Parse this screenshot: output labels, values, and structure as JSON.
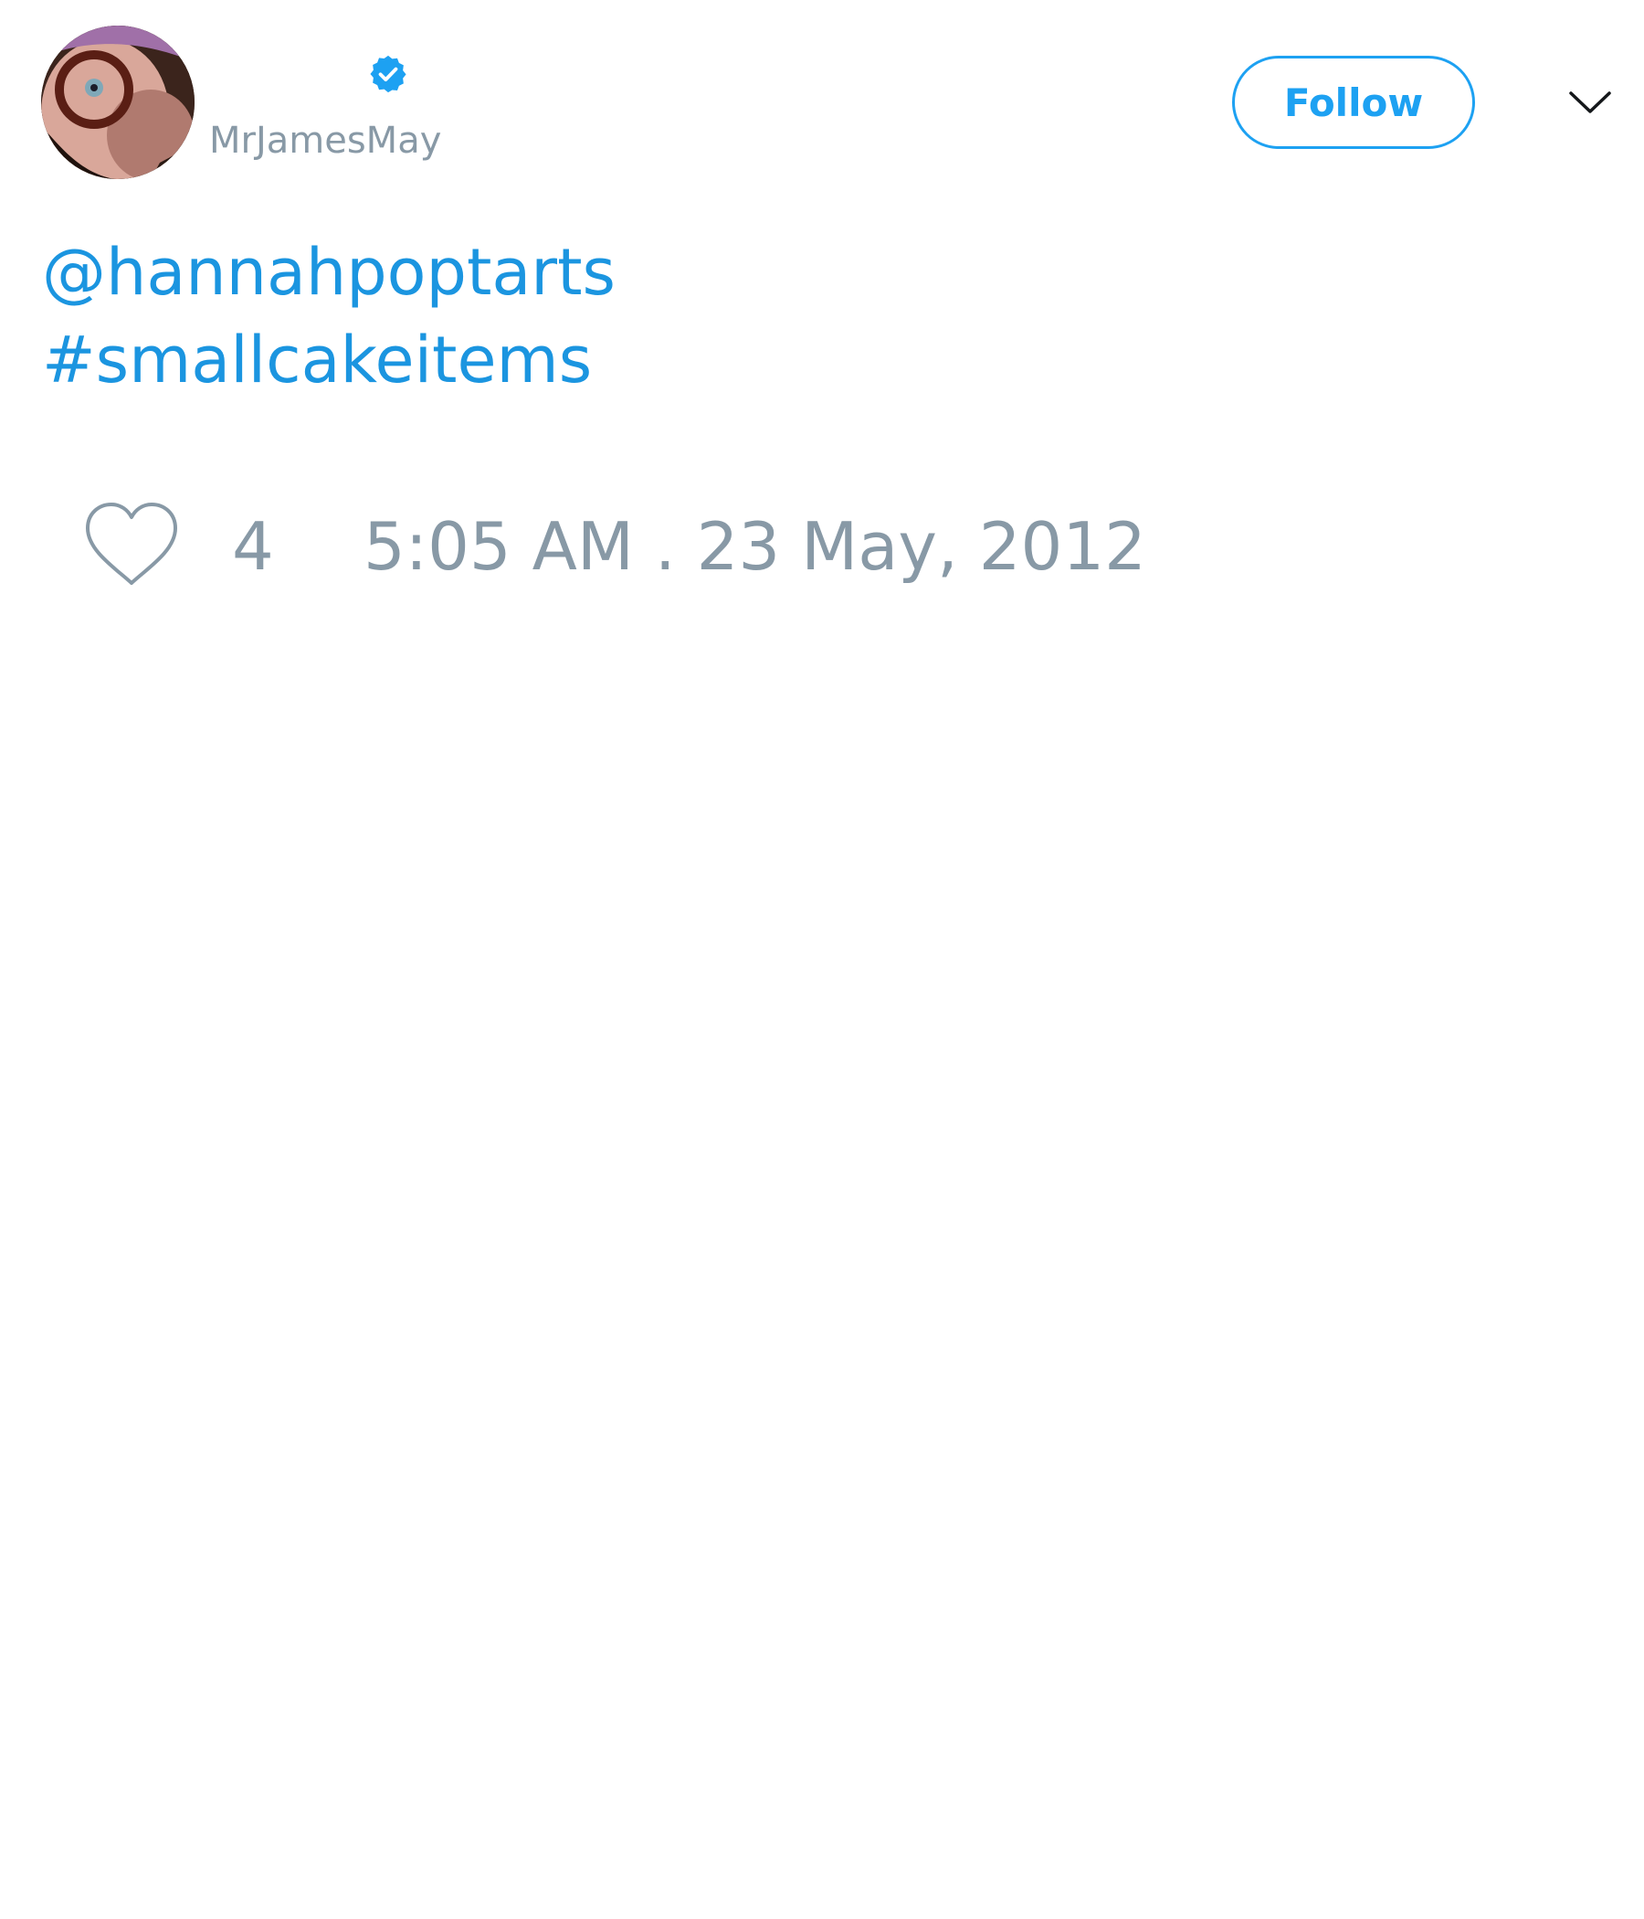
{
  "author": {
    "handle": "MrJamesMay",
    "verified": true,
    "avatar_icon": "profile-photo",
    "verified_icon": "verified-badge-icon"
  },
  "actions": {
    "follow_label": "Follow",
    "menu_icon": "chevron-down-icon"
  },
  "tweet": {
    "mention": "@hannahpoptarts",
    "hashtag": "#smallcakeitems"
  },
  "footer": {
    "like_icon": "heart-icon",
    "like_count": "4",
    "timestamp": "5:05 AM . 23 May, 2012"
  },
  "colors": {
    "accent": "#1da1f2",
    "link": "#1b95e0",
    "muted": "#8899a6",
    "background": "#ffffff"
  }
}
